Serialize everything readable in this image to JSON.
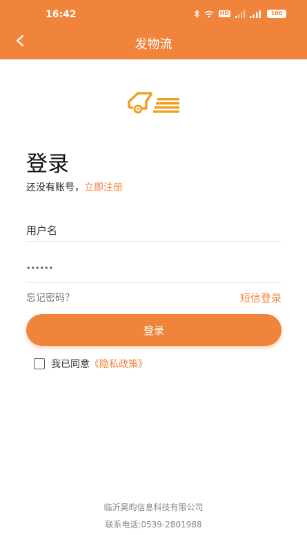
{
  "status_bar": {
    "time": "16:42",
    "hd_label": "HD",
    "battery": "100",
    "icons": [
      "bluetooth-icon",
      "wifi-icon",
      "signal-icon",
      "signal-icon",
      "battery-icon"
    ]
  },
  "nav": {
    "title": "发物流",
    "back_icon": "back-arrow-icon"
  },
  "logo": {
    "icon": "truck-logo-icon",
    "color": "#f0a020"
  },
  "login": {
    "title": "登录",
    "no_account_text": "还没有账号，",
    "register_link": "立即注册",
    "username_placeholder": "用户名",
    "password_value": "••••••",
    "forgot_password": "忘记密码？",
    "sms_login": "短信登录",
    "login_button": "登录",
    "agree_text": "我已同意",
    "privacy_policy": "《隐私政策》"
  },
  "footer": {
    "company": "临沂昊昀信息科技有限公司",
    "phone": "联系电话:0539-2801988"
  },
  "colors": {
    "accent": "#f0843a",
    "header": "#f0843a"
  }
}
